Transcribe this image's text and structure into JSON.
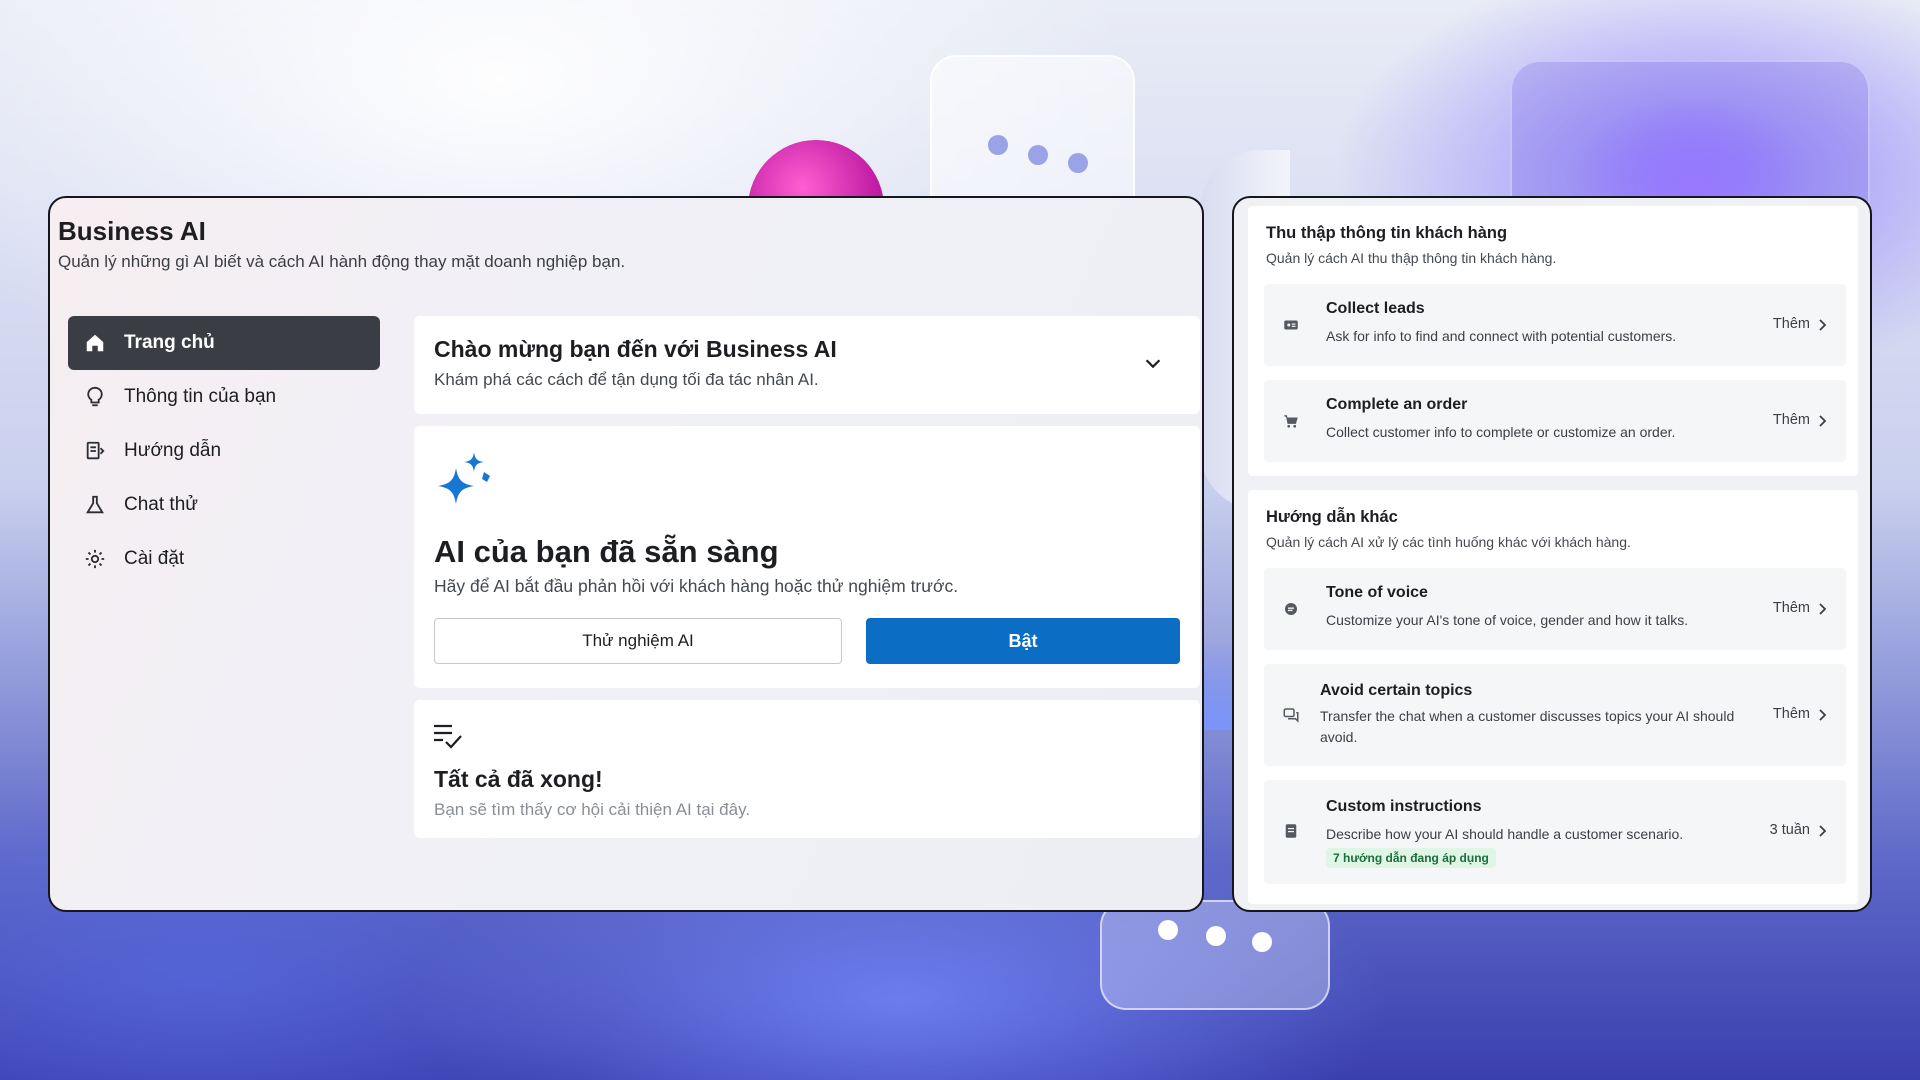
{
  "app": {
    "title": "Business AI",
    "subtitle": "Quản lý những gì AI biết và cách AI hành động thay mặt doanh nghiệp bạn."
  },
  "sidebar": {
    "items": [
      {
        "label": "Trang chủ",
        "icon": "home-icon",
        "active": true
      },
      {
        "label": "Thông tin của bạn",
        "icon": "lightbulb-icon",
        "active": false
      },
      {
        "label": "Hướng dẫn",
        "icon": "guide-icon",
        "active": false
      },
      {
        "label": "Chat thử",
        "icon": "flask-icon",
        "active": false
      },
      {
        "label": "Cài đặt",
        "icon": "gear-icon",
        "active": false
      }
    ]
  },
  "welcome": {
    "title": "Chào mừng bạn đến với Business AI",
    "subtitle": "Khám phá các cách để tận dụng tối đa tác nhân AI."
  },
  "ready": {
    "icon": "sparkle-icon",
    "title": "AI của bạn đã sẵn sàng",
    "subtitle": "Hãy để AI bắt đầu phản hồi với khách hàng hoặc thử nghiệm trước.",
    "test_button": "Thử nghiệm AI",
    "on_button": "Bật"
  },
  "done": {
    "icon": "checklist-icon",
    "title": "Tất cả đã xong!",
    "subtitle": "Bạn sẽ tìm thấy cơ hội cải thiện AI tại đây."
  },
  "collect": {
    "title": "Thu thập thông tin khách hàng",
    "subtitle": "Quản lý cách AI thu thập thông tin khách hàng.",
    "rows": [
      {
        "title": "Collect leads",
        "desc": "Ask for info to find and connect with potential customers.",
        "action": "Thêm",
        "icon": "contact-card-icon"
      },
      {
        "title": "Complete an order",
        "desc": "Collect customer info to complete or customize an order.",
        "action": "Thêm",
        "icon": "cart-icon"
      }
    ]
  },
  "other": {
    "title": "Hướng dẫn khác",
    "subtitle": "Quản lý cách AI xử lý các tình huống khác với khách hàng.",
    "rows": [
      {
        "title": "Tone of voice",
        "desc": "Customize your AI's tone of voice, gender and how it talks.",
        "action": "Thêm",
        "icon": "voice-icon"
      },
      {
        "title": "Avoid certain topics",
        "desc": "Transfer the chat when a customer discusses topics your AI should avoid.",
        "action": "Thêm",
        "icon": "chat-bubbles-icon"
      },
      {
        "title": "Custom instructions",
        "desc": "Describe how your AI should handle a customer scenario.",
        "action": "3 tuần",
        "tag": "7 hướng dẫn đang áp dụng",
        "icon": "document-icon"
      }
    ]
  },
  "colors": {
    "primary_button": "#0c6dc4",
    "active_nav": "#3a3d44",
    "sparkle": "#1877d2",
    "tag_bg": "#dff5e6",
    "tag_text": "#1b6d3a"
  }
}
